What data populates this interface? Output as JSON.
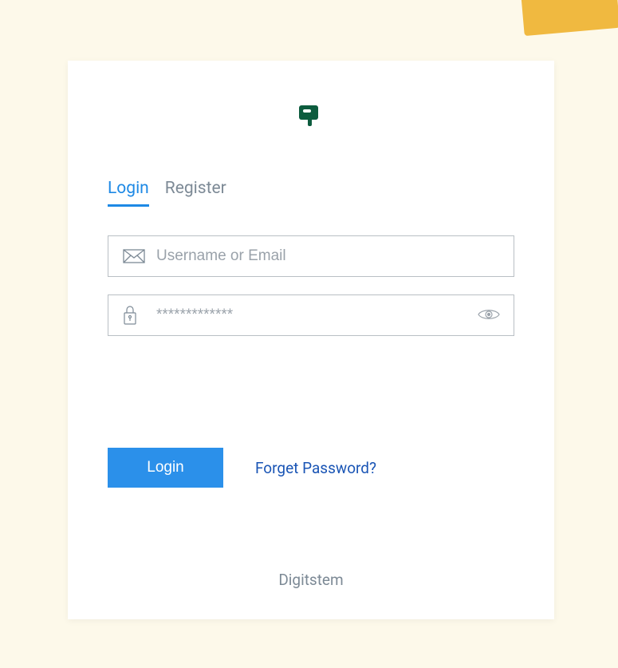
{
  "tabs": {
    "login": "Login",
    "register": "Register"
  },
  "form": {
    "username_placeholder": "Username or Email",
    "password_placeholder": "*************"
  },
  "actions": {
    "login_button": "Login",
    "forgot_password": "Forget Password?"
  },
  "footer": {
    "brand": "Digitstem"
  },
  "colors": {
    "accent": "#2b90ea",
    "logo": "#0d5c3e",
    "background": "#fdf9ea"
  }
}
